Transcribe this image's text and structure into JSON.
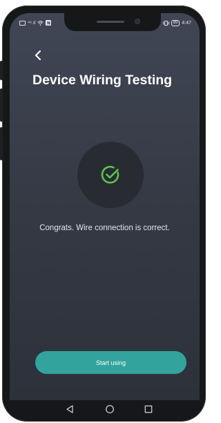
{
  "status_bar": {
    "left_indicators": "⁴⁶.ıl",
    "time": "4:47",
    "battery": "89"
  },
  "header": {
    "back_icon": "chevron-left-icon",
    "title": "Device Wiring Testing"
  },
  "result": {
    "icon": "check-circle-icon",
    "icon_color": "#5cc44f",
    "message": "Congrats. Wire connection is correct."
  },
  "actions": {
    "start_label": "Start using",
    "button_color": "#33a39d"
  },
  "nav": {
    "back_icon": "triangle-back-icon",
    "home_icon": "circle-home-icon",
    "recents_icon": "square-recents-icon"
  }
}
